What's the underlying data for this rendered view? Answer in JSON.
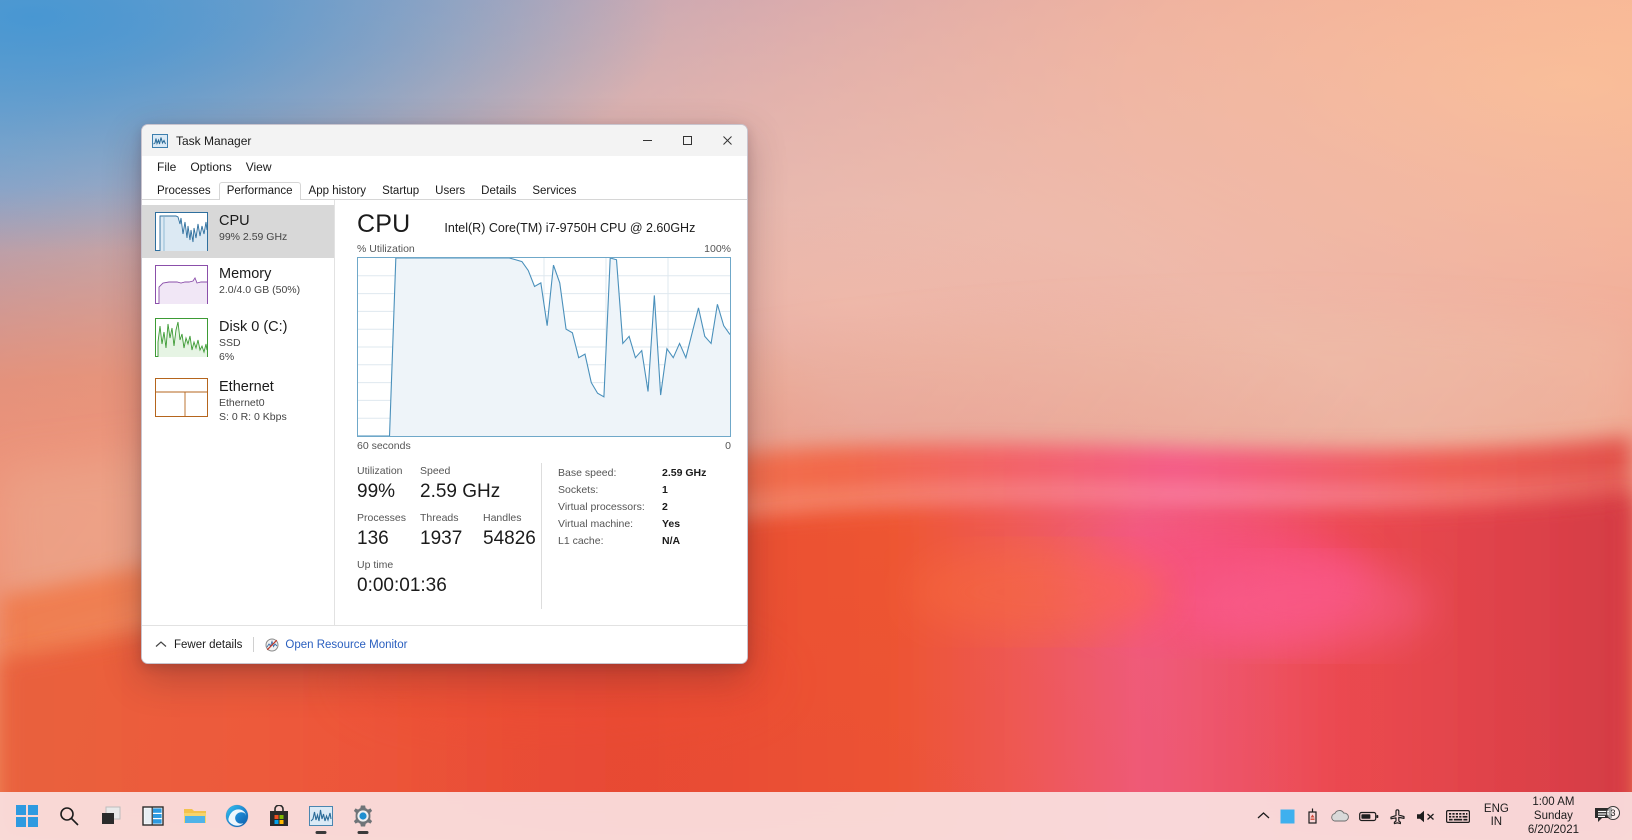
{
  "desktop": {
    "wallpaper_name": "windows-11-bloom-wallpaper"
  },
  "window": {
    "title": "Task Manager",
    "app_icon": "task-manager-icon",
    "controls": {
      "minimize": "minimize-icon",
      "maximize": "maximize-icon",
      "close": "close-icon"
    },
    "menus": [
      "File",
      "Options",
      "View"
    ],
    "tabs": [
      {
        "label": "Processes",
        "active": false
      },
      {
        "label": "Performance",
        "active": true
      },
      {
        "label": "App history",
        "active": false
      },
      {
        "label": "Startup",
        "active": false
      },
      {
        "label": "Users",
        "active": false
      },
      {
        "label": "Details",
        "active": false
      },
      {
        "label": "Services",
        "active": false
      }
    ]
  },
  "sidebar": {
    "items": [
      {
        "name": "CPU",
        "title": "CPU",
        "sub1": "99%  2.59 GHz",
        "sub2": "",
        "selected": true,
        "accent": "#2e6f9e",
        "fill": "#dce9f3"
      },
      {
        "name": "Memory",
        "title": "Memory",
        "sub1": "2.0/4.0 GB (50%)",
        "sub2": "",
        "selected": false,
        "accent": "#8b4faa",
        "fill": "#f1e7f6"
      },
      {
        "name": "Disk 0 (C:)",
        "title": "Disk 0 (C:)",
        "sub1": "SSD",
        "sub2": "6%",
        "selected": false,
        "accent": "#3d9b35",
        "fill": "#e6f4e4"
      },
      {
        "name": "Ethernet",
        "title": "Ethernet",
        "sub1": "Ethernet0",
        "sub2": "S: 0 R: 0 Kbps",
        "selected": false,
        "accent": "#b5651d",
        "fill": "#fbf2e8"
      }
    ]
  },
  "detail": {
    "title": "CPU",
    "model": "Intel(R) Core(TM) i7-9750H CPU @ 2.60GHz",
    "graph_axis_label": "% Utilization",
    "graph_max_label": "100%",
    "graph_time_label": "60 seconds",
    "graph_min_label": "0",
    "stats": {
      "utilization_label": "Utilization",
      "utilization_value": "99%",
      "speed_label": "Speed",
      "speed_value": "2.59 GHz",
      "processes_label": "Processes",
      "processes_value": "136",
      "threads_label": "Threads",
      "threads_value": "1937",
      "handles_label": "Handles",
      "handles_value": "54826",
      "uptime_label": "Up time",
      "uptime_value": "0:00:01:36"
    },
    "properties": [
      {
        "label": "Base speed:",
        "value": "2.59 GHz"
      },
      {
        "label": "Sockets:",
        "value": "1"
      },
      {
        "label": "Virtual processors:",
        "value": "2"
      },
      {
        "label": "Virtual machine:",
        "value": "Yes"
      },
      {
        "label": "L1 cache:",
        "value": "N/A"
      }
    ]
  },
  "footer": {
    "fewer_details_label": "Fewer details",
    "fewer_details_icon": "chevron-up-icon",
    "resource_monitor_label": "Open Resource Monitor",
    "resource_monitor_icon": "resource-monitor-icon",
    "link_color": "#2a5fbf"
  },
  "taskbar": {
    "buttons": [
      {
        "name": "start-button",
        "icon": "windows-logo-icon",
        "active": false
      },
      {
        "name": "search-button",
        "icon": "search-icon",
        "active": false
      },
      {
        "name": "task-view-button",
        "icon": "task-view-icon",
        "active": false
      },
      {
        "name": "widgets-button",
        "icon": "widgets-icon",
        "active": false
      },
      {
        "name": "file-explorer-button",
        "icon": "folder-icon",
        "active": false
      },
      {
        "name": "edge-button",
        "icon": "edge-browser-icon",
        "active": false
      },
      {
        "name": "store-button",
        "icon": "microsoft-store-icon",
        "active": false
      },
      {
        "name": "task-manager-button",
        "icon": "task-manager-icon",
        "active": true
      },
      {
        "name": "settings-button",
        "icon": "gear-icon",
        "active": true
      }
    ],
    "tray": [
      {
        "name": "show-hidden-icons-button",
        "icon": "chevron-up-icon"
      },
      {
        "name": "tray-app-button",
        "icon": "blue-square-icon"
      },
      {
        "name": "safely-remove-hardware-button",
        "icon": "usb-eject-icon"
      },
      {
        "name": "onedrive-button",
        "icon": "cloud-icon"
      },
      {
        "name": "battery-button",
        "icon": "battery-icon"
      },
      {
        "name": "airplane-mode-button",
        "icon": "airplane-icon"
      },
      {
        "name": "volume-button",
        "icon": "speaker-muted-icon"
      },
      {
        "name": "touch-keyboard-button",
        "icon": "keyboard-icon"
      }
    ],
    "language": {
      "line1": "ENG",
      "line2": "IN"
    },
    "clock": {
      "time": "1:00 AM",
      "day": "Sunday",
      "date": "6/20/2021"
    },
    "notifications": {
      "icon": "notification-icon",
      "count": "3"
    }
  },
  "chart_data": {
    "type": "area",
    "title": "CPU % Utilization over 60 seconds",
    "xlabel": "60 seconds",
    "ylabel": "% Utilization",
    "ylim": [
      0,
      100
    ],
    "xlim": [
      0,
      60
    ],
    "grid": true,
    "legend": false,
    "line_color": "#4a90bb",
    "fill_color": "#eef4f9",
    "y_ticks": [
      0,
      10,
      20,
      30,
      40,
      50,
      60,
      70,
      80,
      90,
      100
    ],
    "x_gridlines": 6,
    "series": [
      {
        "name": "CPU utilization",
        "values": [
          0,
          0,
          0,
          0,
          0,
          0,
          100,
          100,
          100,
          100,
          100,
          100,
          100,
          100,
          100,
          100,
          100,
          100,
          100,
          100,
          100,
          100,
          100,
          100,
          100,
          99,
          98,
          93,
          84,
          86,
          62,
          96,
          86,
          60,
          58,
          44,
          46,
          30,
          24,
          22,
          100,
          99,
          52,
          56,
          44,
          48,
          25,
          79,
          23,
          49,
          44,
          52,
          44,
          58,
          72,
          56,
          52,
          74,
          62,
          57
        ]
      }
    ]
  }
}
